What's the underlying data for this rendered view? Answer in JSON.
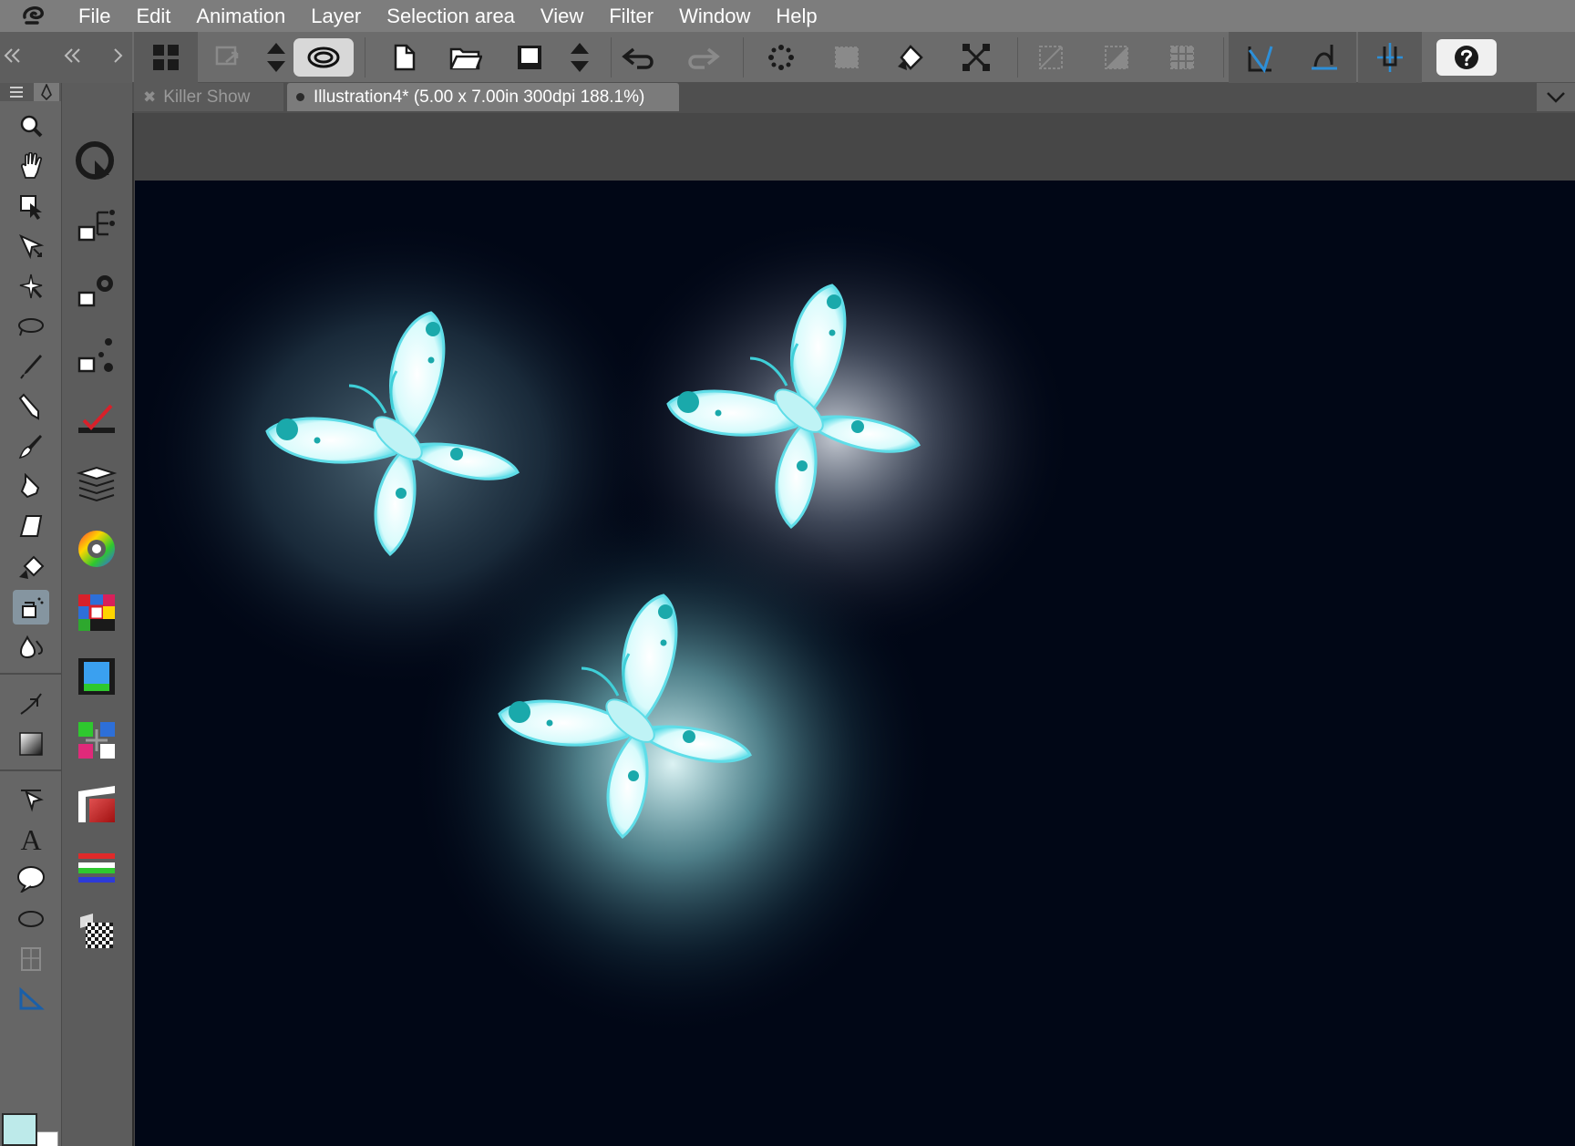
{
  "menu": {
    "items": [
      "File",
      "Edit",
      "Animation",
      "Layer",
      "Selection area",
      "View",
      "Filter",
      "Window",
      "Help"
    ]
  },
  "toolbar": {
    "icons": [
      "grid-icon",
      "import-icon",
      "up-down-arrows-icon",
      "clip-studio-icon",
      "new-file-icon",
      "open-folder-icon",
      "save-icon",
      "up-down-arrows-icon",
      "undo-icon",
      "redo-icon",
      "snap-points-icon",
      "selection-frame-icon",
      "fill-bucket-icon",
      "transform-icon",
      "clear-icon",
      "fill-selection-icon",
      "grid-toggle-icon",
      "ruler-snap-icon",
      "special-ruler-snap-icon",
      "grid-snap-icon",
      "help-icon"
    ]
  },
  "tabs": [
    {
      "label": "Killer Show",
      "active": false
    },
    {
      "label": "Illustration4* (5.00 x 7.00in 300dpi 188.1%)",
      "active": true
    }
  ],
  "tools": {
    "items": [
      "zoom-icon",
      "hand-icon",
      "object-icon",
      "move-layer-icon",
      "auto-select-icon",
      "lasso-icon",
      "pen-icon",
      "pencil-icon",
      "brush-icon",
      "marker-icon",
      "eraser-icon",
      "fill-icon",
      "airbrush-icon",
      "blend-icon",
      "figure-pen-icon",
      "gradient-icon",
      "operation-icon",
      "text-icon",
      "balloon-icon",
      "ellipse-icon",
      "frame-icon",
      "ruler-icon"
    ]
  },
  "panels": {
    "items": [
      "navigator-icon",
      "sub-tool-icon",
      "tool-property-icon",
      "brush-size-icon",
      "layer-property-icon",
      "layers-icon",
      "color-wheel-icon",
      "color-set-icon",
      "animation-timeline-icon",
      "color-history-icon",
      "intermediate-color-icon",
      "color-slider-icon",
      "material-icon"
    ]
  },
  "colors": {
    "main": "#bdeaea",
    "sub": "#ffffff",
    "canvas": "#010716",
    "accent": "#3ec8d8"
  }
}
